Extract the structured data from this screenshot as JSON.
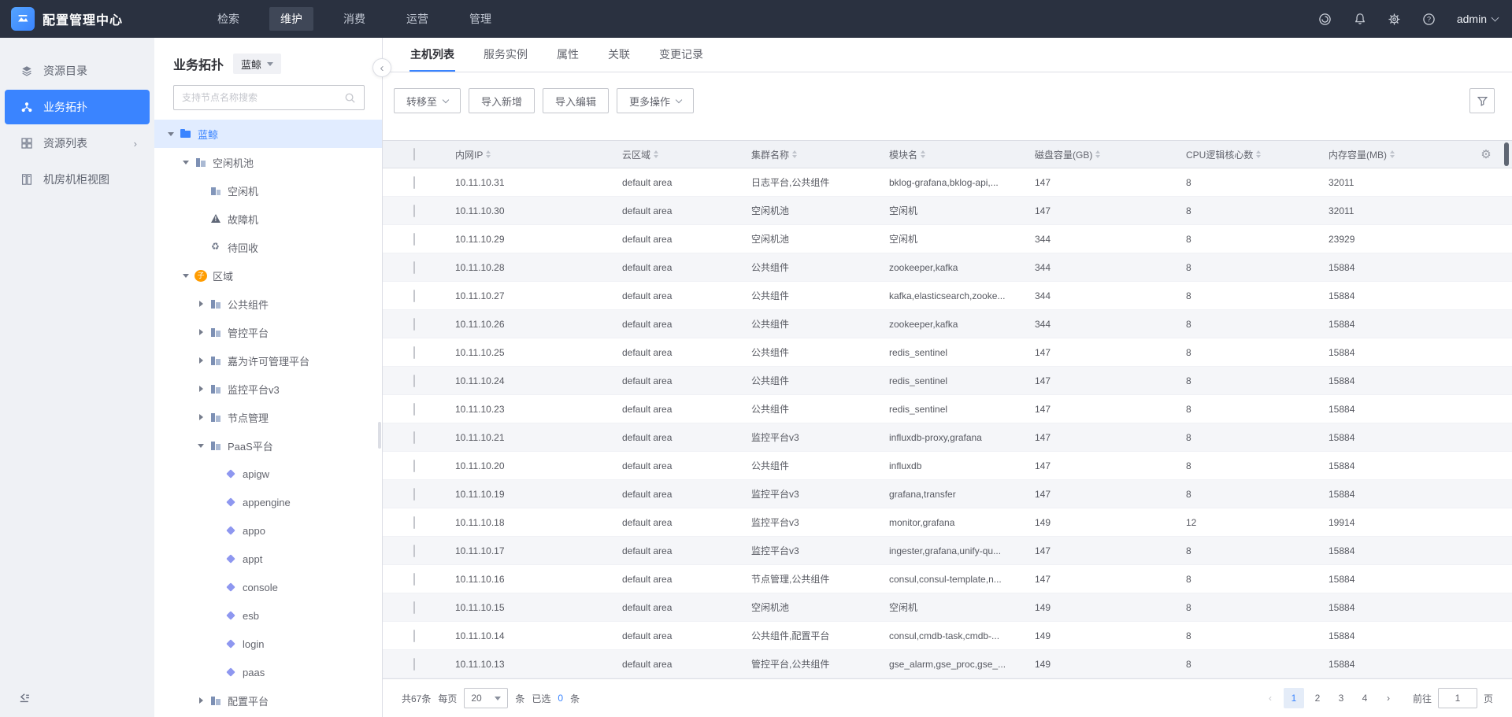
{
  "header": {
    "app_title": "配置管理中心",
    "nav_items": [
      {
        "label": "检索"
      },
      {
        "label": "维护",
        "active": true
      },
      {
        "label": "消费"
      },
      {
        "label": "运营"
      },
      {
        "label": "管理"
      }
    ],
    "user_name": "admin"
  },
  "sidebar": {
    "items": [
      {
        "label": "资源目录",
        "icon": "layers"
      },
      {
        "label": "业务拓扑",
        "icon": "topology",
        "active": true
      },
      {
        "label": "资源列表",
        "icon": "grid",
        "arrow": true
      },
      {
        "label": "机房机柜视图",
        "icon": "cabinet"
      }
    ]
  },
  "topo": {
    "panel_title": "业务拓扑",
    "business_name": "蓝鲸",
    "search_placeholder": "支持节点名称搜索",
    "tree": [
      {
        "label": "蓝鲸",
        "level": 0,
        "icon": "folder",
        "caret": "down",
        "selected": true
      },
      {
        "label": "空闲机池",
        "level": 1,
        "icon": "set",
        "caret": "down"
      },
      {
        "label": "空闲机",
        "level": 2,
        "icon": "host",
        "caret": "none"
      },
      {
        "label": "故障机",
        "level": 2,
        "icon": "warning",
        "caret": "none"
      },
      {
        "label": "待回收",
        "level": 2,
        "icon": "recycle",
        "caret": "none"
      },
      {
        "label": "区域",
        "level": 1,
        "icon": "custom",
        "caret": "down",
        "badge": "子"
      },
      {
        "label": "公共组件",
        "level": 2,
        "icon": "set",
        "caret": "right"
      },
      {
        "label": "管控平台",
        "level": 2,
        "icon": "set",
        "caret": "right"
      },
      {
        "label": "嘉为许可管理平台",
        "level": 2,
        "icon": "set",
        "caret": "right"
      },
      {
        "label": "监控平台v3",
        "level": 2,
        "icon": "set",
        "caret": "right"
      },
      {
        "label": "节点管理",
        "level": 2,
        "icon": "set",
        "caret": "right"
      },
      {
        "label": "PaaS平台",
        "level": 2,
        "icon": "set",
        "caret": "down"
      },
      {
        "label": "apigw",
        "level": 3,
        "icon": "module",
        "caret": "none"
      },
      {
        "label": "appengine",
        "level": 3,
        "icon": "module",
        "caret": "none"
      },
      {
        "label": "appo",
        "level": 3,
        "icon": "module",
        "caret": "none"
      },
      {
        "label": "appt",
        "level": 3,
        "icon": "module",
        "caret": "none"
      },
      {
        "label": "console",
        "level": 3,
        "icon": "module",
        "caret": "none"
      },
      {
        "label": "esb",
        "level": 3,
        "icon": "module",
        "caret": "none"
      },
      {
        "label": "login",
        "level": 3,
        "icon": "module",
        "caret": "none"
      },
      {
        "label": "paas",
        "level": 3,
        "icon": "module",
        "caret": "none"
      },
      {
        "label": "配置平台",
        "level": 2,
        "icon": "set",
        "caret": "right"
      }
    ]
  },
  "main": {
    "tabs": [
      {
        "label": "主机列表",
        "active": true
      },
      {
        "label": "服务实例"
      },
      {
        "label": "属性"
      },
      {
        "label": "关联"
      },
      {
        "label": "变更记录"
      }
    ],
    "toolbar": {
      "buttons": [
        {
          "label": "转移至",
          "dropdown": true
        },
        {
          "label": "导入新增"
        },
        {
          "label": "导入编辑"
        },
        {
          "label": "更多操作",
          "dropdown": true
        }
      ]
    },
    "table": {
      "columns": [
        {
          "label": "内网IP"
        },
        {
          "label": "云区域"
        },
        {
          "label": "集群名称"
        },
        {
          "label": "模块名"
        },
        {
          "label": "磁盘容量(GB)"
        },
        {
          "label": "CPU逻辑核心数"
        },
        {
          "label": "内存容量(MB)"
        }
      ],
      "rows": [
        {
          "ip": "10.11.10.31",
          "cloud": "default area",
          "cluster": "日志平台,公共组件",
          "module": "bklog-grafana,bklog-api,...",
          "disk": "147",
          "cpu": "8",
          "mem": "32011"
        },
        {
          "ip": "10.11.10.30",
          "cloud": "default area",
          "cluster": "空闲机池",
          "module": "空闲机",
          "disk": "147",
          "cpu": "8",
          "mem": "32011"
        },
        {
          "ip": "10.11.10.29",
          "cloud": "default area",
          "cluster": "空闲机池",
          "module": "空闲机",
          "disk": "344",
          "cpu": "8",
          "mem": "23929"
        },
        {
          "ip": "10.11.10.28",
          "cloud": "default area",
          "cluster": "公共组件",
          "module": "zookeeper,kafka",
          "disk": "344",
          "cpu": "8",
          "mem": "15884"
        },
        {
          "ip": "10.11.10.27",
          "cloud": "default area",
          "cluster": "公共组件",
          "module": "kafka,elasticsearch,zooke...",
          "disk": "344",
          "cpu": "8",
          "mem": "15884"
        },
        {
          "ip": "10.11.10.26",
          "cloud": "default area",
          "cluster": "公共组件",
          "module": "zookeeper,kafka",
          "disk": "344",
          "cpu": "8",
          "mem": "15884"
        },
        {
          "ip": "10.11.10.25",
          "cloud": "default area",
          "cluster": "公共组件",
          "module": "redis_sentinel",
          "disk": "147",
          "cpu": "8",
          "mem": "15884"
        },
        {
          "ip": "10.11.10.24",
          "cloud": "default area",
          "cluster": "公共组件",
          "module": "redis_sentinel",
          "disk": "147",
          "cpu": "8",
          "mem": "15884"
        },
        {
          "ip": "10.11.10.23",
          "cloud": "default area",
          "cluster": "公共组件",
          "module": "redis_sentinel",
          "disk": "147",
          "cpu": "8",
          "mem": "15884"
        },
        {
          "ip": "10.11.10.21",
          "cloud": "default area",
          "cluster": "监控平台v3",
          "module": "influxdb-proxy,grafana",
          "disk": "147",
          "cpu": "8",
          "mem": "15884"
        },
        {
          "ip": "10.11.10.20",
          "cloud": "default area",
          "cluster": "公共组件",
          "module": "influxdb",
          "disk": "147",
          "cpu": "8",
          "mem": "15884"
        },
        {
          "ip": "10.11.10.19",
          "cloud": "default area",
          "cluster": "监控平台v3",
          "module": "grafana,transfer",
          "disk": "147",
          "cpu": "8",
          "mem": "15884"
        },
        {
          "ip": "10.11.10.18",
          "cloud": "default area",
          "cluster": "监控平台v3",
          "module": "monitor,grafana",
          "disk": "149",
          "cpu": "12",
          "mem": "19914"
        },
        {
          "ip": "10.11.10.17",
          "cloud": "default area",
          "cluster": "监控平台v3",
          "module": "ingester,grafana,unify-qu...",
          "disk": "147",
          "cpu": "8",
          "mem": "15884"
        },
        {
          "ip": "10.11.10.16",
          "cloud": "default area",
          "cluster": "节点管理,公共组件",
          "module": "consul,consul-template,n...",
          "disk": "147",
          "cpu": "8",
          "mem": "15884"
        },
        {
          "ip": "10.11.10.15",
          "cloud": "default area",
          "cluster": "空闲机池",
          "module": "空闲机",
          "disk": "149",
          "cpu": "8",
          "mem": "15884"
        },
        {
          "ip": "10.11.10.14",
          "cloud": "default area",
          "cluster": "公共组件,配置平台",
          "module": "consul,cmdb-task,cmdb-...",
          "disk": "149",
          "cpu": "8",
          "mem": "15884"
        },
        {
          "ip": "10.11.10.13",
          "cloud": "default area",
          "cluster": "管控平台,公共组件",
          "module": "gse_alarm,gse_proc,gse_...",
          "disk": "149",
          "cpu": "8",
          "mem": "15884"
        }
      ]
    },
    "pagination": {
      "total": "共67条",
      "per_page_label": "每页",
      "per_page": "20",
      "per_page_unit": "条",
      "selected_label": "已选",
      "selected_count": "0",
      "selected_unit": "条",
      "pages": [
        {
          "label": "1",
          "active": true
        },
        {
          "label": "2"
        },
        {
          "label": "3"
        },
        {
          "label": "4"
        }
      ],
      "goto_label": "前往",
      "goto_value": "1",
      "goto_unit": "页"
    }
  }
}
